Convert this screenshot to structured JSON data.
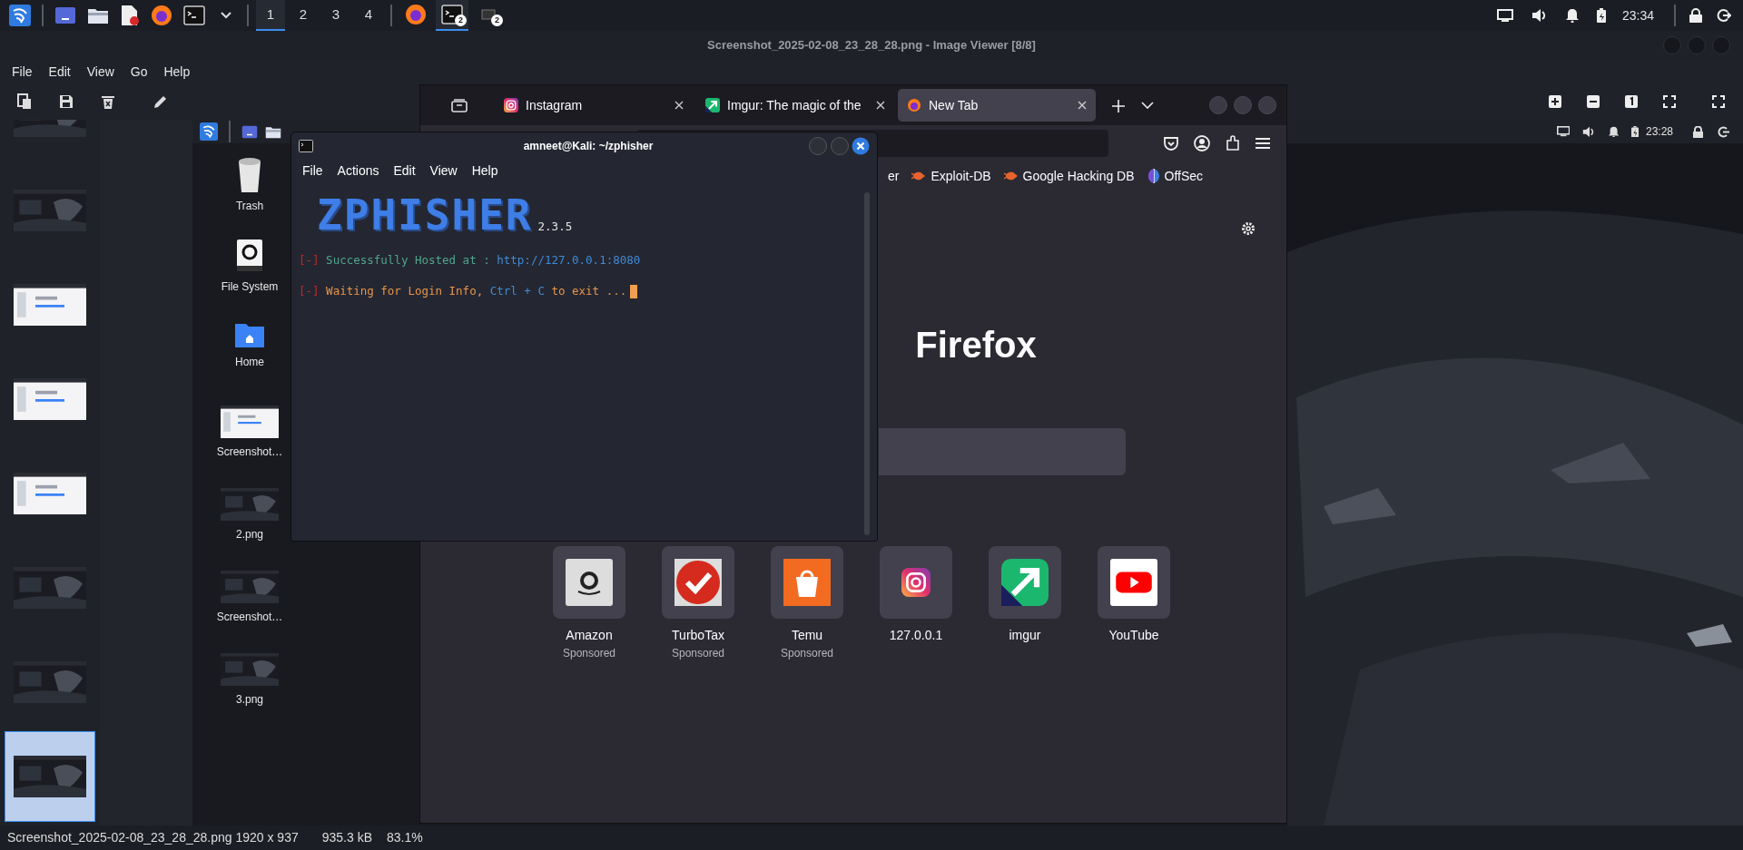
{
  "panel": {
    "launchers": [
      {
        "kind": "kali"
      },
      {
        "kind": "screen"
      },
      {
        "kind": "folder"
      },
      {
        "kind": "document"
      },
      {
        "kind": "firefox"
      },
      {
        "kind": "terminal"
      },
      {
        "kind": "caret"
      }
    ],
    "workspaces": [
      {
        "label": "1",
        "selected": true
      },
      {
        "label": "2",
        "selected": false
      },
      {
        "label": "3",
        "selected": false
      },
      {
        "label": "4",
        "selected": false
      }
    ],
    "tasks": [
      {
        "kind": "firefox",
        "selected": false
      },
      {
        "kind": "terminal",
        "badge": "2",
        "selected": true
      },
      {
        "kind": "window",
        "badge": "2",
        "selected": false
      }
    ],
    "clock": "23:34"
  },
  "viewer": {
    "title": "Screenshot_2025-02-08_23_28_28.png - Image Viewer [8/8]",
    "menu": [
      "File",
      "Edit",
      "View",
      "Go",
      "Help"
    ],
    "thumbnails": [
      {
        "kind": "dark",
        "selected": false
      },
      {
        "kind": "dark",
        "selected": false
      },
      {
        "kind": "light",
        "selected": false
      },
      {
        "kind": "light",
        "selected": false
      },
      {
        "kind": "light",
        "selected": false
      },
      {
        "kind": "dark",
        "selected": false
      },
      {
        "kind": "dark",
        "selected": false
      },
      {
        "kind": "dark",
        "selected": true
      }
    ],
    "status": {
      "file": "Screenshot_2025-02-08_23_28_28.png 1920 x 937",
      "size": "935.3 kB",
      "zoom": "83.1%"
    }
  },
  "desktop": {
    "clock": "23:28",
    "icons": [
      {
        "kind": "trash",
        "label": "Trash"
      },
      {
        "kind": "drive",
        "label": "File System"
      },
      {
        "kind": "folder",
        "label": "Home"
      },
      {
        "kind": "shot-light",
        "label": "Screenshot…"
      },
      {
        "kind": "shot-dark",
        "label": "2.png"
      },
      {
        "kind": "shot-dark",
        "label": "Screenshot…"
      },
      {
        "kind": "shot-dark",
        "label": "3.png"
      }
    ]
  },
  "firefox": {
    "tabs": [
      {
        "kind": "instagram",
        "label": "Instagram",
        "selected": false
      },
      {
        "kind": "imgur",
        "label": "Imgur: The magic of the",
        "selected": false
      },
      {
        "kind": "firefox",
        "label": "New Tab",
        "selected": true
      }
    ],
    "bookmarks": [
      {
        "kind": "cut",
        "label": "er"
      },
      {
        "kind": "exploit",
        "label": "Exploit-DB"
      },
      {
        "kind": "exploit",
        "label": "Google Hacking DB"
      },
      {
        "kind": "offsec",
        "label": "OffSec"
      }
    ],
    "wordmark": "Firefox",
    "shortcuts": [
      {
        "kind": "amazon",
        "label": "Amazon",
        "note": "Sponsored"
      },
      {
        "kind": "turbotax",
        "label": "TurboTax",
        "note": "Sponsored"
      },
      {
        "kind": "temu",
        "label": "Temu",
        "note": "Sponsored"
      },
      {
        "kind": "instagram",
        "label": "127.0.0.1"
      },
      {
        "kind": "imgur",
        "label": "imgur"
      },
      {
        "kind": "youtube",
        "label": "YouTube"
      }
    ]
  },
  "terminal": {
    "title": "amneet@Kali: ~/zphisher",
    "menu": [
      "File",
      "Actions",
      "Edit",
      "View",
      "Help"
    ],
    "banner": "ZPHISHER",
    "version": "2.3.5",
    "lines": [
      {
        "parts": [
          {
            "kind": "bracket",
            "text": "[-]"
          },
          {
            "kind": "success",
            "text": "Successfully Hosted at :"
          },
          {
            "kind": "link",
            "text": "http://127.0.0.1:8080"
          }
        ],
        "cursor": false
      },
      {
        "parts": [
          {
            "kind": "bracket",
            "text": "[-]"
          },
          {
            "kind": "warn",
            "text": "Waiting for Login Info,"
          },
          {
            "kind": "key",
            "text": "Ctrl + C"
          },
          {
            "kind": "warn",
            "text": "to exit ..."
          }
        ],
        "cursor": true
      }
    ]
  }
}
